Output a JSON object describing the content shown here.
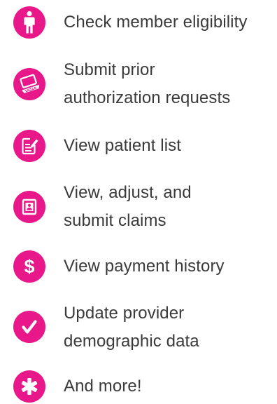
{
  "accent_color": "#e8178a",
  "text_color": "#3a3a3a",
  "items": [
    {
      "icon": "person-icon",
      "lines": [
        "Check member eligibility"
      ]
    },
    {
      "icon": "laptop-icon",
      "lines": [
        "Submit prior",
        "authorization requests"
      ]
    },
    {
      "icon": "edit-document-icon",
      "lines": [
        "View patient list"
      ]
    },
    {
      "icon": "id-card-icon",
      "lines": [
        "View, adjust, and",
        "submit claims"
      ]
    },
    {
      "icon": "dollar-icon",
      "lines": [
        "View payment history"
      ]
    },
    {
      "icon": "checkmark-icon",
      "lines": [
        "Update provider",
        "demographic data"
      ]
    },
    {
      "icon": "asterisk-icon",
      "lines": [
        "And more!"
      ]
    }
  ]
}
